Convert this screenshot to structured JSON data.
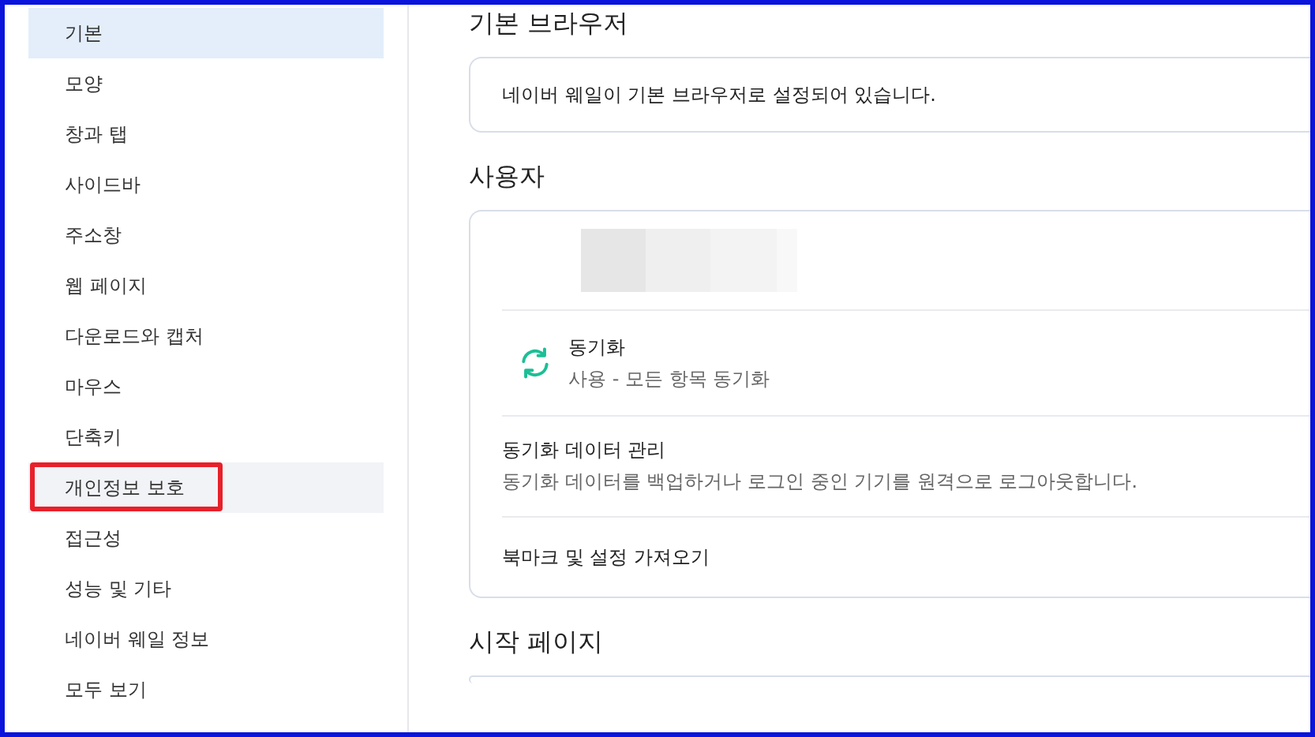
{
  "sidebar": {
    "items": [
      {
        "label": "기본",
        "selected": true,
        "hovered": false,
        "marked": false
      },
      {
        "label": "모양",
        "selected": false,
        "hovered": false,
        "marked": false
      },
      {
        "label": "창과 탭",
        "selected": false,
        "hovered": false,
        "marked": false
      },
      {
        "label": "사이드바",
        "selected": false,
        "hovered": false,
        "marked": false
      },
      {
        "label": "주소창",
        "selected": false,
        "hovered": false,
        "marked": false
      },
      {
        "label": "웹 페이지",
        "selected": false,
        "hovered": false,
        "marked": false
      },
      {
        "label": "다운로드와 캡처",
        "selected": false,
        "hovered": false,
        "marked": false
      },
      {
        "label": "마우스",
        "selected": false,
        "hovered": false,
        "marked": false
      },
      {
        "label": "단축키",
        "selected": false,
        "hovered": false,
        "marked": false
      },
      {
        "label": "개인정보 보호",
        "selected": false,
        "hovered": true,
        "marked": true
      },
      {
        "label": "접근성",
        "selected": false,
        "hovered": false,
        "marked": false
      },
      {
        "label": "성능 및 기타",
        "selected": false,
        "hovered": false,
        "marked": false
      },
      {
        "label": "네이버 웨일 정보",
        "selected": false,
        "hovered": false,
        "marked": false
      },
      {
        "label": "모두 보기",
        "selected": false,
        "hovered": false,
        "marked": false
      }
    ]
  },
  "sections": [
    {
      "heading": "기본 브라우저",
      "rows": [
        {
          "kind": "text",
          "title": "네이버 웨일이 기본 브라우저로 설정되어 있습니다."
        }
      ]
    },
    {
      "heading": "사용자",
      "rows": [
        {
          "kind": "account"
        },
        {
          "kind": "sync",
          "title": "동기화",
          "subtitle": "사용 - 모든 항목 동기화"
        },
        {
          "kind": "link",
          "title": "동기화 데이터 관리",
          "subtitle": "동기화 데이터를 백업하거나 로그인 중인 기기를 원격으로 로그아웃합니다."
        },
        {
          "kind": "link",
          "title": "북마크 및 설정 가져오기"
        }
      ]
    },
    {
      "heading": "시작 페이지"
    }
  ]
}
